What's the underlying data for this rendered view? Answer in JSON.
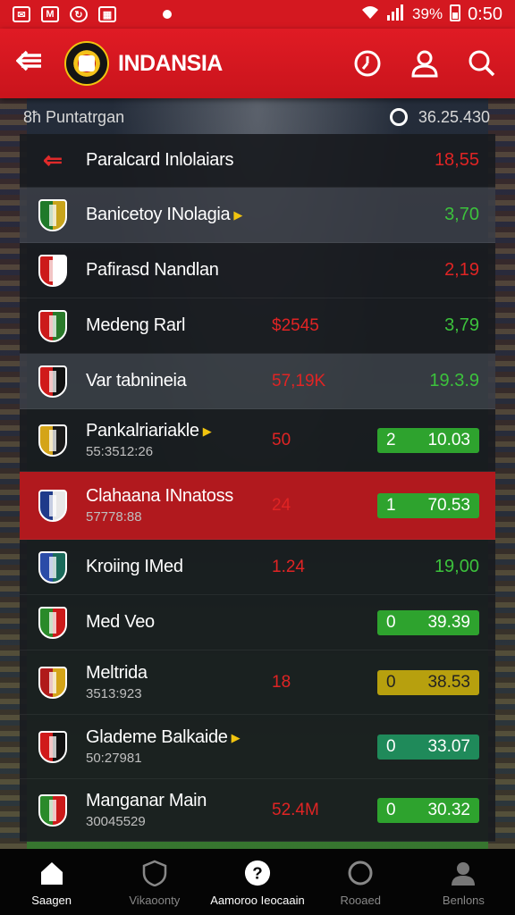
{
  "status_bar": {
    "battery": "39%",
    "time": "0:50"
  },
  "header": {
    "title": "INDANSIA"
  },
  "sub_header": {
    "label": "8ħ Puntatrgan",
    "value": "36.25.430"
  },
  "rows": [
    {
      "name": "Paralcard Inlolaiars",
      "sub": "",
      "mid": "",
      "value": "18,55",
      "value_color": "#e02424",
      "pill": null,
      "style": "plain",
      "badge": "back-arrow",
      "crest": [
        "#000",
        "#000"
      ],
      "arrow": false
    },
    {
      "name": "Banicetoy INolagia",
      "sub": "",
      "mid": "",
      "value": "3,70",
      "value_color": "#3cc23c",
      "pill": null,
      "style": "alt",
      "badge": "crest",
      "crest": [
        "#1f7a2a",
        "#c8a41c"
      ],
      "arrow": true
    },
    {
      "name": "Pafirasd Nandlan",
      "sub": "",
      "mid": "",
      "value": "2,19",
      "value_color": "#e02424",
      "pill": null,
      "style": "plain",
      "badge": "crest",
      "crest": [
        "#cc1a1a",
        "#ffffff"
      ],
      "arrow": false
    },
    {
      "name": "Medeng Rarl",
      "sub": "",
      "mid": "$2545",
      "value": "3,79",
      "value_color": "#3cc23c",
      "pill": null,
      "style": "plain",
      "badge": "crest",
      "crest": [
        "#cc1a1a",
        "#2a7a2a"
      ],
      "arrow": false
    },
    {
      "name": "Var tabnineia",
      "sub": "",
      "mid": "57,19K",
      "value": "19.3.9",
      "value_color": "#3cc23c",
      "pill": null,
      "style": "alt",
      "badge": "crest",
      "crest": [
        "#d01a1a",
        "#111111"
      ],
      "arrow": false
    },
    {
      "name": "Pankalriariakle",
      "sub": "55:3512:26",
      "mid": "50",
      "value": "",
      "value_color": "",
      "pill": {
        "n": "2",
        "v": "10.03",
        "color": "green"
      },
      "style": "plain",
      "badge": "crest",
      "crest": [
        "#d4a418",
        "#1a1a1a"
      ],
      "arrow": true
    },
    {
      "name": "Clahaana INnatoss",
      "sub": "57778:88",
      "mid": "24",
      "value": "",
      "value_color": "",
      "pill": {
        "n": "1",
        "v": "70.53",
        "color": "green"
      },
      "style": "sel",
      "badge": "crest",
      "crest": [
        "#1f3a8a",
        "#e8e8e8"
      ],
      "arrow": false
    },
    {
      "name": "Kroiing IMed",
      "sub": "",
      "mid": "1.24",
      "value": "19,00",
      "value_color": "#3cc23c",
      "pill": null,
      "style": "plain",
      "badge": "crest",
      "crest": [
        "#2a4ca8",
        "#1a6a5a"
      ],
      "arrow": false
    },
    {
      "name": "Med Veo",
      "sub": "",
      "mid": "",
      "value": "",
      "value_color": "",
      "pill": {
        "n": "0",
        "v": "39.39",
        "color": "green"
      },
      "style": "plain",
      "badge": "crest",
      "crest": [
        "#2a8a2a",
        "#cc1a1a"
      ],
      "arrow": false
    },
    {
      "name": "Meltrida",
      "sub": "3513:923",
      "mid": "18",
      "value": "",
      "value_color": "",
      "pill": {
        "n": "0",
        "v": "38.53",
        "color": "yellow"
      },
      "style": "plain",
      "badge": "crest",
      "crest": [
        "#b01a1a",
        "#d4a418"
      ],
      "arrow": false
    },
    {
      "name": "Glademe Balkaide",
      "sub": "50:27981",
      "mid": "",
      "value": "",
      "value_color": "",
      "pill": {
        "n": "0",
        "v": "33.07",
        "color": "teal"
      },
      "style": "plain",
      "badge": "crest",
      "crest": [
        "#d01a1a",
        "#111111"
      ],
      "arrow": true
    },
    {
      "name": "Manganar Main",
      "sub": "30045529",
      "mid": "52.4M",
      "value": "",
      "value_color": "",
      "pill": {
        "n": "0",
        "v": "30.32",
        "color": "green"
      },
      "style": "plain",
      "badge": "crest",
      "crest": [
        "#2a8a2a",
        "#cc1a1a"
      ],
      "arrow": false
    }
  ],
  "bottom_nav": [
    {
      "label": "Saagen",
      "icon": "home-icon",
      "active": true
    },
    {
      "label": "Vikaoonty",
      "icon": "shield-icon",
      "active": false
    },
    {
      "label": "Aamoroo Ieocaain",
      "icon": "help-icon",
      "active": true
    },
    {
      "label": "Rooaed",
      "icon": "circle-icon",
      "active": false
    },
    {
      "label": "Benlons",
      "icon": "person-icon",
      "active": false
    }
  ]
}
